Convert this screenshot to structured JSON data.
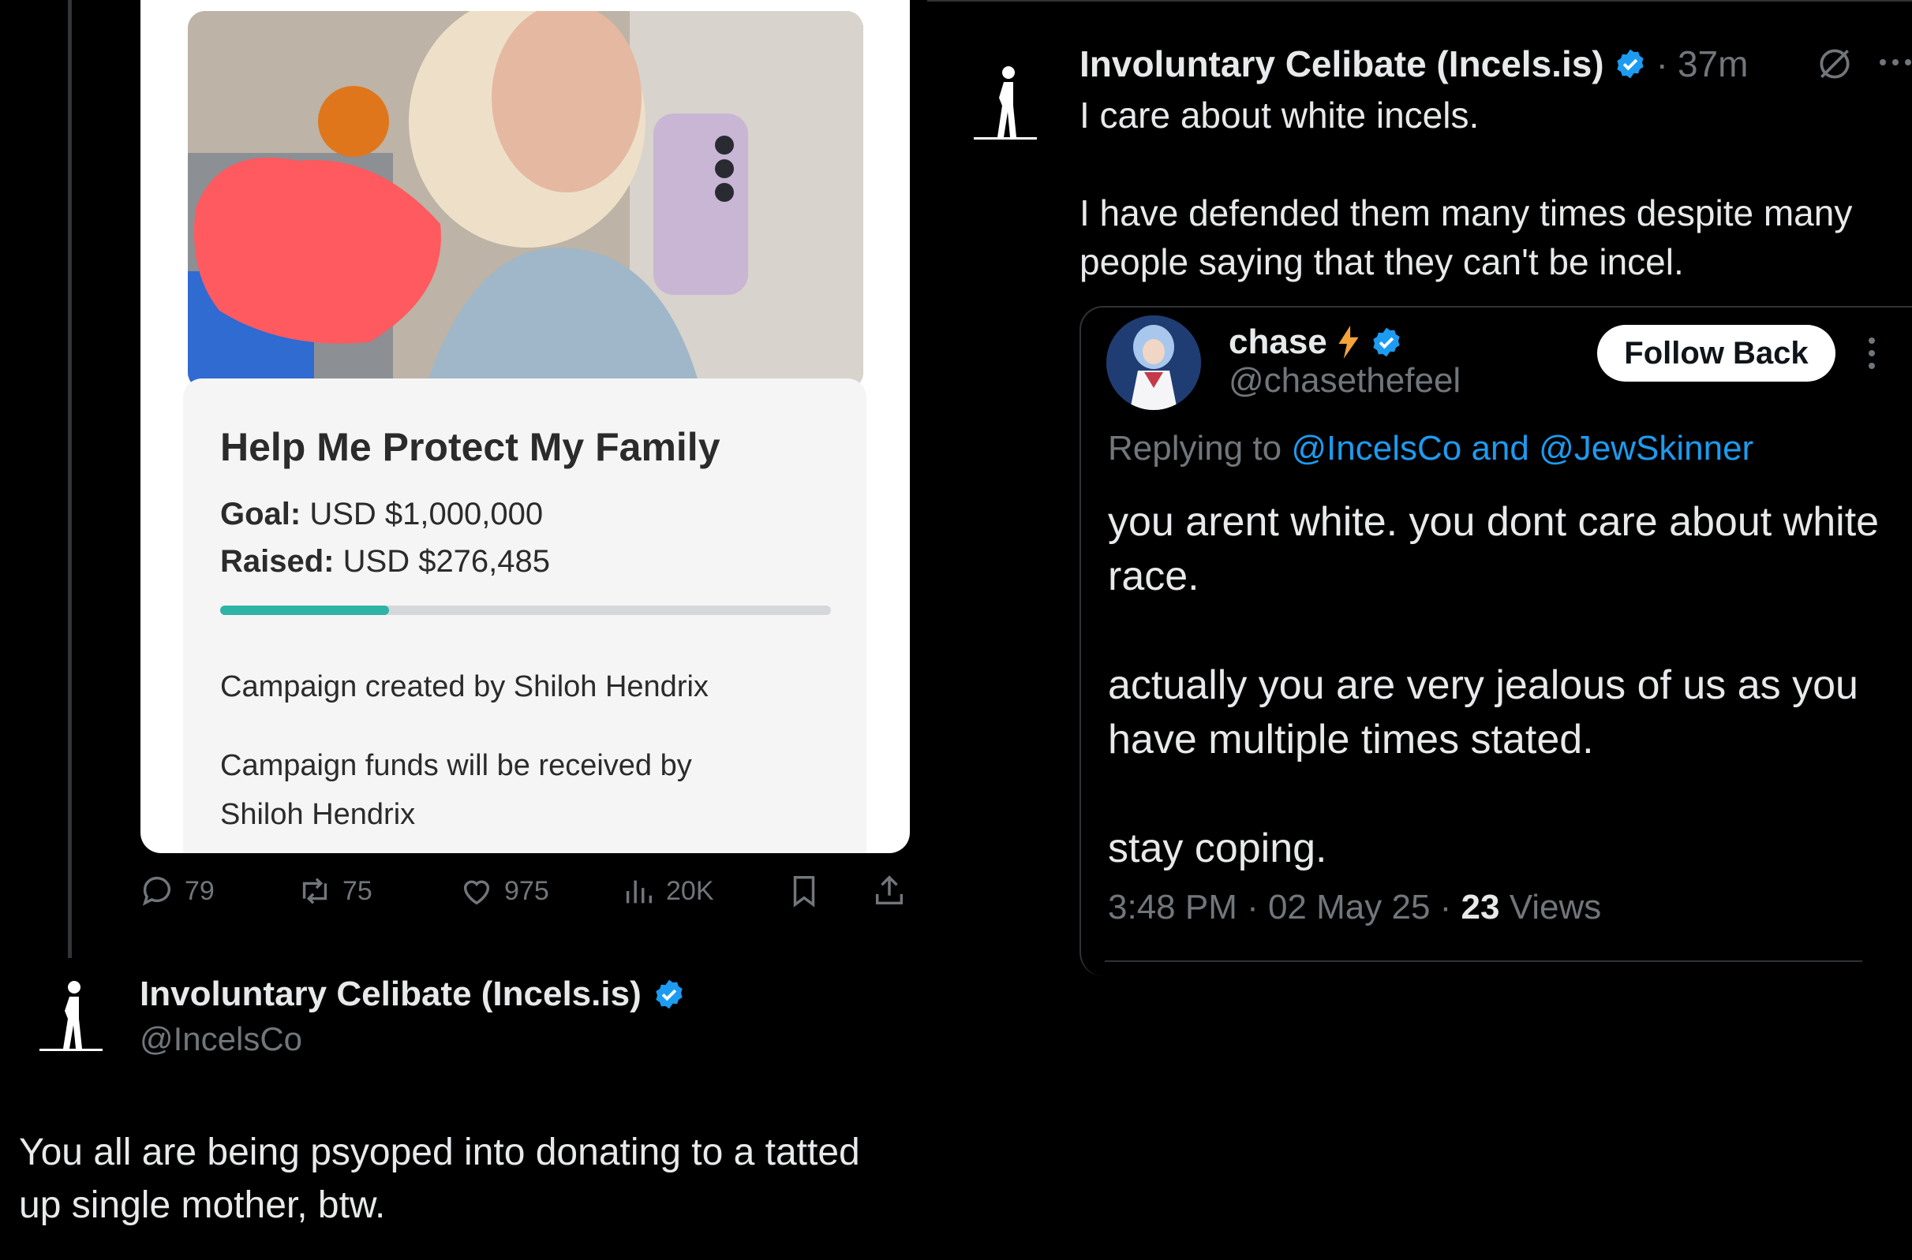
{
  "left_tweet_media": {
    "campaign_title": "Help Me Protect My Family",
    "goal_label": "Goal:",
    "goal_value": "USD $1,000,000",
    "raised_label": "Raised:",
    "raised_value": "USD $276,485",
    "progress_fraction": 0.276,
    "created_by_label": "Campaign created by",
    "created_by_name": "Shiloh Hendrix",
    "funds_label": "Campaign funds will be received by",
    "funds_name": "Shiloh Hendrix"
  },
  "left_actions": {
    "replies": "79",
    "reposts": "75",
    "likes": "975",
    "views": "20K"
  },
  "left_reply": {
    "author_name": "Involuntary Celibate (Incels.is)",
    "author_handle": "@IncelsCo",
    "body": "You all are being psyoped into donating to a tatted up single mother, btw."
  },
  "right_tweet": {
    "author_name": "Involuntary Celibate (Incels.is)",
    "dot": "·",
    "time": "37m",
    "body_line1": "I care about white incels.",
    "body_line2": "I have defended them many times despite many people saying that they can't be incel."
  },
  "quoted_tweet": {
    "author_name": "chase",
    "author_handle": "@chasethefeel",
    "follow_label": "Follow Back",
    "replying_prefix": "Replying to",
    "replying_targets": "@IncelsCo and @JewSkinner",
    "body_p1": "you arent white. you dont care about white race.",
    "body_p2": "actually you are very jealous of us as you have multiple times stated.",
    "body_p3": "stay coping.",
    "time": "3:48 PM · 02 May 25 ·",
    "views_count": "23",
    "views_label": "Views"
  },
  "colors": {
    "background": "#000000",
    "text": "#e7e9ea",
    "muted": "#71767b",
    "link": "#1d9bf0",
    "verified": "#1d9bf0",
    "progress": "#2fb3a5"
  },
  "icons": {
    "reply": "comment-icon",
    "repost": "repost-icon",
    "like": "heart-icon",
    "views": "views-icon",
    "bookmark": "bookmark-icon",
    "share": "share-icon",
    "grok": "grok-icon",
    "more": "more-icon",
    "verified": "verified-badge-icon",
    "lightning": "lightning-icon"
  }
}
